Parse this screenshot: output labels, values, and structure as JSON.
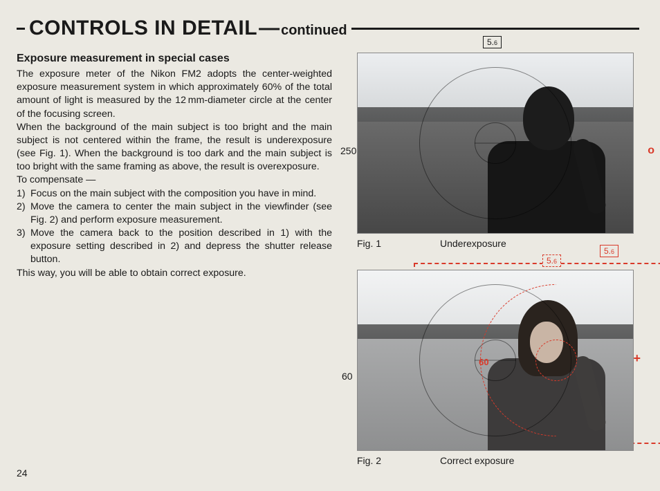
{
  "header": {
    "main": "CONTROLS IN DETAIL",
    "dash": "—",
    "sub": "continued"
  },
  "subheading": "Exposure measurement in special cases",
  "para1": "The exposure meter of the Nikon FM2 adopts the center-weighted exposure measurement system in which approximately 60% of the total amount of light is measured by the 12 mm-diameter circle at the center of the focusing screen.",
  "para2": "When the background of the main subject is too bright and the main subject is not centered within the frame, the result is underexposure (see Fig. 1). When the background is too dark and the main subject is too bright with the same framing as above, the result is overexposure.",
  "compensate_label": "To compensate —",
  "steps": {
    "n1": "1)",
    "t1": "Focus on the main subject with the composition you have in mind.",
    "n2": "2)",
    "t2": "Move the camera to center the main subject in the viewfinder (see Fig. 2) and perform exposure measurement.",
    "n3": "3)",
    "t3": "Move the camera back to the position described in 1) with the exposure setting described in 2) and depress the shutter release button."
  },
  "closing": "This way, you will be able to obtain correct exposure.",
  "fig1": {
    "aperture_main": "5.",
    "aperture_sub": "6",
    "shutter": "250",
    "led": "o",
    "label": "Fig. 1",
    "caption": "Underexposure"
  },
  "fig2": {
    "aperture_main": "5.",
    "aperture_sub": "6",
    "dashed_aperture_main": "5.",
    "dashed_aperture_sub": "6",
    "shutter": "60",
    "dashed_shutter": "60",
    "led": "+",
    "label": "Fig. 2",
    "caption": "Correct exposure"
  },
  "page_number": "24"
}
